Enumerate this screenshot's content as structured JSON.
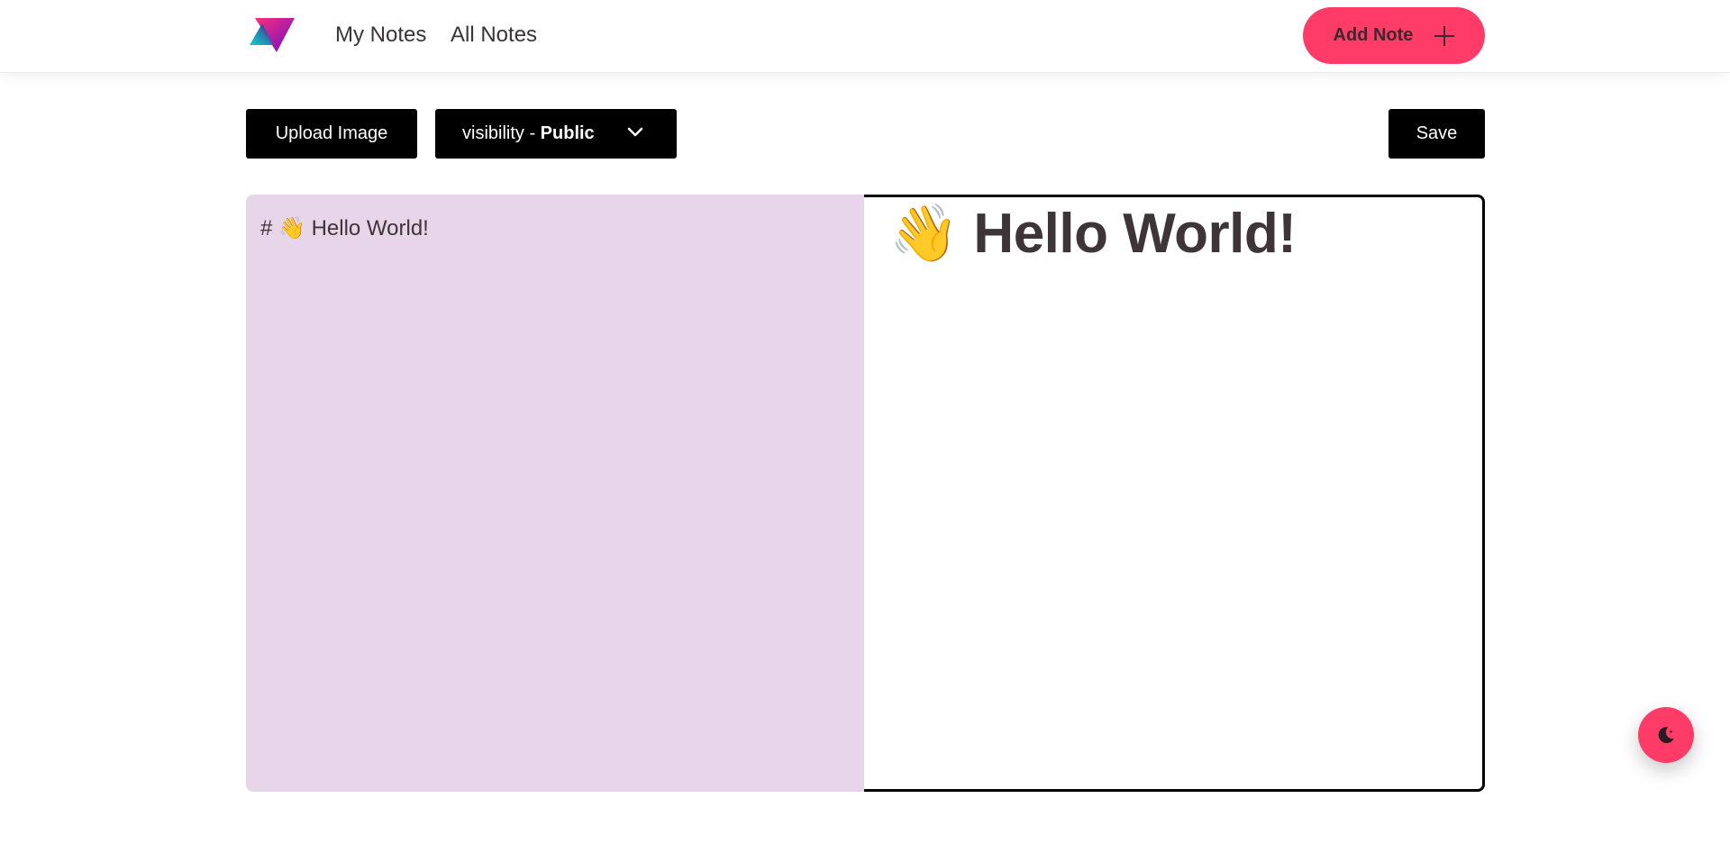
{
  "nav": {
    "logo_name": "app-logo",
    "links": [
      "My Notes",
      "All Notes"
    ],
    "add_note_label": "Add Note"
  },
  "toolbar": {
    "upload_label": "Upload Image",
    "visibility_prefix": "visibility - ",
    "visibility_value": "Public",
    "save_label": "Save"
  },
  "editor": {
    "input_text": "# 👋 Hello World!",
    "preview_heading": "👋 Hello World!"
  },
  "colors": {
    "accent": "#ff3b67",
    "editor_bg": "#e7d5ea",
    "button_bg": "#000000",
    "text": "#3d3537"
  },
  "icons": {
    "add": "plus-icon",
    "dropdown": "chevron-down-icon",
    "theme": "moon-icon"
  }
}
